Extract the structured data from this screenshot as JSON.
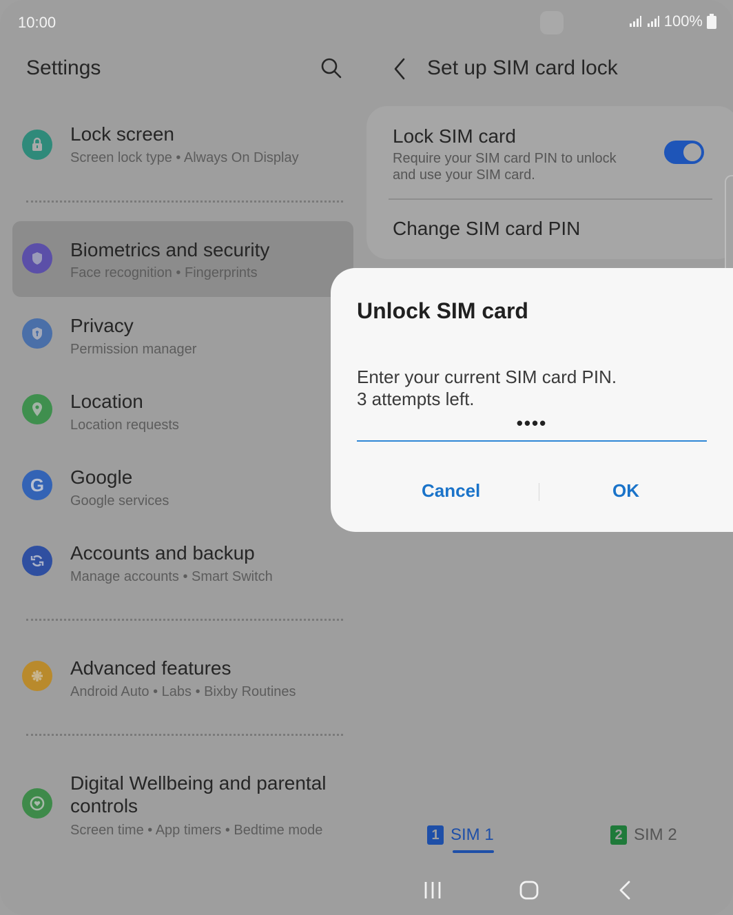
{
  "status_bar": {
    "time": "10:00",
    "battery": "100%",
    "icons": [
      "signal-sim1-icon",
      "signal-sim2-icon",
      "battery-icon"
    ]
  },
  "left_pane": {
    "title": "Settings",
    "search_icon": "search-icon",
    "items": [
      {
        "title": "Lock screen",
        "subtitle": "Screen lock type  •  Always On Display",
        "icon": "lock-icon",
        "color": "#2f8a7a"
      },
      {
        "title": "Biometrics and security",
        "subtitle": "Face recognition  •  Fingerprints",
        "icon": "shield-icon",
        "color": "#5b4fa8"
      },
      {
        "title": "Privacy",
        "subtitle": "Permission manager",
        "icon": "privacy-shield-icon",
        "color": "#4a6fa8"
      },
      {
        "title": "Location",
        "subtitle": "Location requests",
        "icon": "location-pin-icon",
        "color": "#3f8f4e"
      },
      {
        "title": "Google",
        "subtitle": "Google services",
        "icon": "google-icon",
        "color": "#3363b5"
      },
      {
        "title": "Accounts and backup",
        "subtitle": "Manage accounts  •  Smart Switch",
        "icon": "sync-icon",
        "color": "#2f4fa0"
      },
      {
        "title": "Advanced features",
        "subtitle": "Android Auto  •  Labs  •  Bixby Routines",
        "icon": "puzzle-gear-icon",
        "color": "#b98a2c"
      },
      {
        "title": "Digital Wellbeing and parental",
        "title2": "controls",
        "subtitle": "Screen time  •  App timers  •  Bedtime mode",
        "icon": "wellbeing-heart-icon",
        "color": "#3e8a4a"
      }
    ]
  },
  "right_pane": {
    "title": "Set up SIM card lock",
    "lock_sim": {
      "title": "Lock SIM card",
      "desc_line1": "Require your SIM card PIN to unlock",
      "desc_line2": "and use your SIM card.",
      "enabled": true
    },
    "change_pin": "Change SIM card PIN",
    "sim_tabs": [
      {
        "badge": "1",
        "label": "SIM 1",
        "selected": true,
        "color": "#1e4fa8"
      },
      {
        "badge": "2",
        "label": "SIM 2",
        "selected": false,
        "color": "#1f7a3a"
      }
    ]
  },
  "dialog": {
    "title": "Unlock SIM card",
    "message_line1": "Enter your current SIM card PIN.",
    "message_line2": "3 attempts left.",
    "pin_value": "••••",
    "cancel_label": "Cancel",
    "ok_label": "OK"
  },
  "nav_bar": {
    "icons": [
      "recent-apps-icon",
      "home-icon",
      "back-icon"
    ]
  }
}
